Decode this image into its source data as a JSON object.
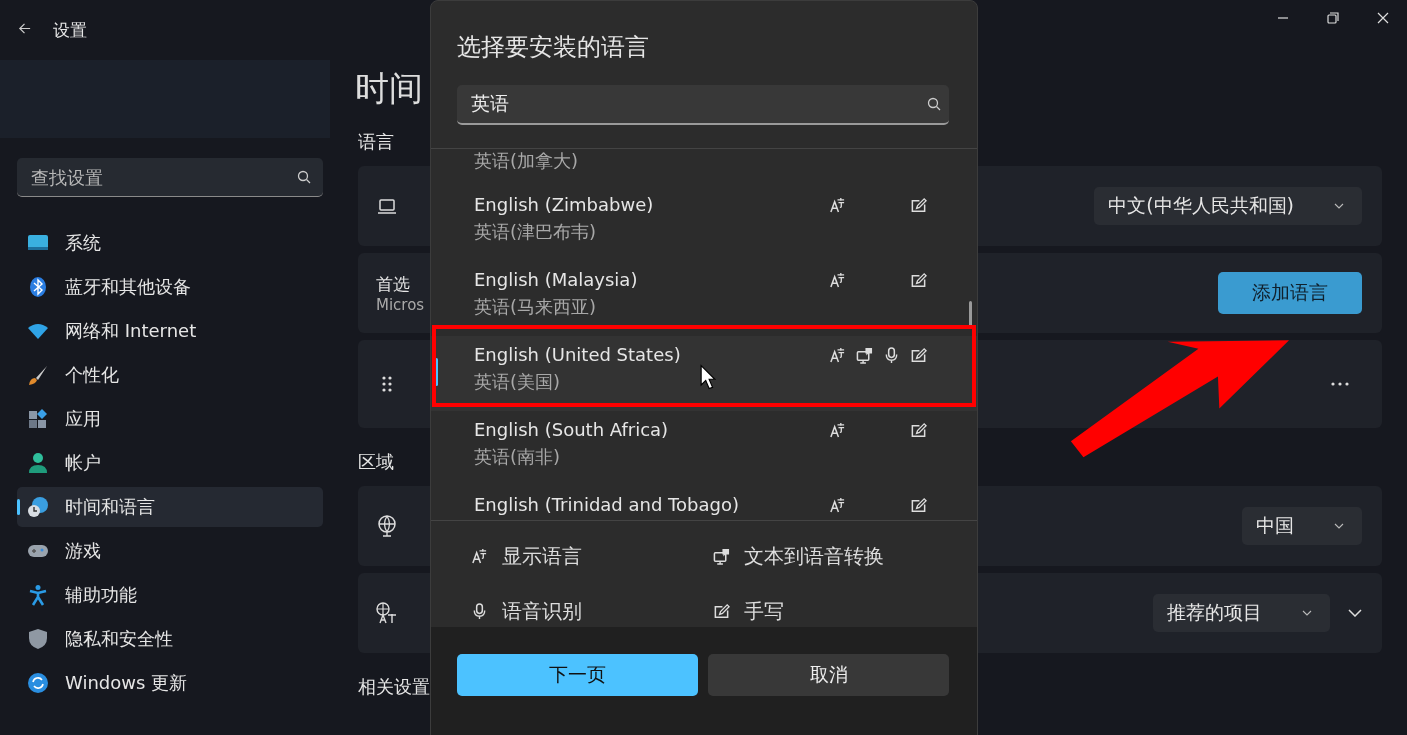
{
  "window": {
    "title": "设置"
  },
  "sidebar": {
    "search": {
      "placeholder": "查找设置"
    },
    "items": [
      {
        "label": "系统",
        "selected": false
      },
      {
        "label": "蓝牙和其他设备",
        "selected": false
      },
      {
        "label": "网络和 Internet",
        "selected": false
      },
      {
        "label": "个性化",
        "selected": false
      },
      {
        "label": "应用",
        "selected": false
      },
      {
        "label": "帐户",
        "selected": false
      },
      {
        "label": "时间和语言",
        "selected": true
      },
      {
        "label": "游戏",
        "selected": false
      },
      {
        "label": "辅助功能",
        "selected": false
      },
      {
        "label": "隐私和安全性",
        "selected": false
      },
      {
        "label": "Windows 更新",
        "selected": false
      }
    ]
  },
  "page": {
    "title": "时间",
    "sections": [
      {
        "heading": "语言",
        "cards": [
          {
            "dropdown": "中文(中华人民共和国)"
          },
          {
            "title": "首选",
            "subtitle": "Micros",
            "button": "添加语言"
          },
          {
            "more": true
          }
        ]
      },
      {
        "heading": "区域",
        "cards": [
          {
            "dropdown": "中国"
          },
          {
            "dropdown": "推荐的项目",
            "expand": true
          }
        ]
      },
      {
        "heading": "相关设置"
      }
    ]
  },
  "dialog": {
    "title": "选择要安装的语言",
    "search": {
      "value": "英语"
    },
    "languages": [
      {
        "native": "英语(加拿大)",
        "selected": false
      },
      {
        "name": "English (Zimbabwe)",
        "native": "英语(津巴布韦)",
        "display": true,
        "tts": false,
        "speech": false,
        "handwriting": true,
        "selected": false
      },
      {
        "name": "English (Malaysia)",
        "native": "英语(马来西亚)",
        "display": true,
        "tts": false,
        "speech": false,
        "handwriting": true,
        "selected": false
      },
      {
        "name": "English (United States)",
        "native": "英语(美国)",
        "display": true,
        "tts": true,
        "speech": true,
        "handwriting": true,
        "selected": true
      },
      {
        "name": "English (South Africa)",
        "native": "英语(南非)",
        "display": true,
        "tts": false,
        "speech": false,
        "handwriting": true,
        "selected": false
      },
      {
        "name": "English (Trinidad and Tobago)",
        "display": true,
        "tts": false,
        "speech": false,
        "handwriting": true,
        "selected": false
      }
    ],
    "legend": [
      {
        "kind": "display",
        "label": "显示语言"
      },
      {
        "kind": "tts",
        "label": "文本到语音转换"
      },
      {
        "kind": "speech",
        "label": "语音识别"
      },
      {
        "kind": "handwriting",
        "label": "手写"
      }
    ],
    "buttons": [
      {
        "label": "下一页",
        "kind": "primary"
      },
      {
        "label": "取消",
        "kind": "secondary"
      }
    ]
  }
}
